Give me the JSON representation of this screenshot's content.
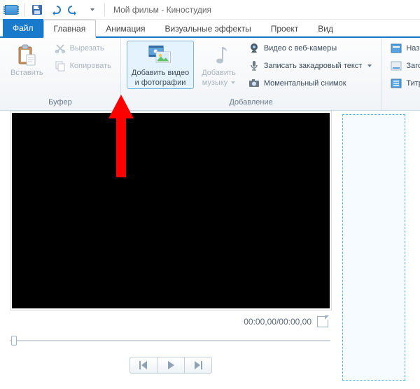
{
  "title": "Мой фильм - Киностудия",
  "tabs": {
    "file": "Файл",
    "home": "Главная",
    "animation": "Анимация",
    "effects": "Визуальные эффекты",
    "project": "Проект",
    "view": "Вид"
  },
  "ribbon": {
    "clipboard": {
      "paste": "Вставить",
      "cut": "Вырезать",
      "copy": "Копировать",
      "group_label": "Буфер"
    },
    "add": {
      "add_media_l1": "Добавить видео",
      "add_media_l2": "и фотографии",
      "add_music_l1": "Добавить",
      "add_music_l2": "музыку",
      "webcam": "Видео с веб-камеры",
      "narration": "Записать закадровый текст",
      "snapshot": "Моментальный снимок",
      "group_label": "Добавление"
    },
    "text": {
      "title": "Название",
      "caption": "Заголовок",
      "credits": "Титры"
    }
  },
  "preview": {
    "time": "00:00,00/00:00,00"
  }
}
